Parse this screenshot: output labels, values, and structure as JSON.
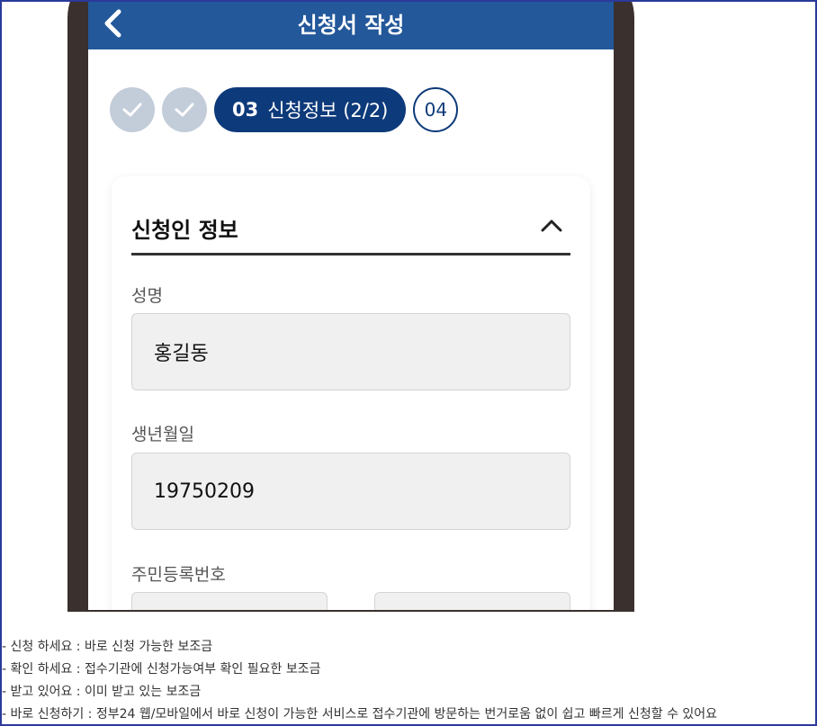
{
  "appbar": {
    "title": "신청서 작성",
    "back_icon": "chevron-left-icon"
  },
  "stepper": {
    "steps_done": 2,
    "current": {
      "number": "03",
      "label": "신청정보 (2/2)"
    },
    "next": {
      "number": "04"
    },
    "colors": {
      "done": "#c3ccd9",
      "current": "#0d3a7a"
    }
  },
  "section": {
    "title": "신청인 정보",
    "toggle_icon": "chevron-up-icon",
    "fields": {
      "name_label": "성명",
      "name_value": "홍길동",
      "birth_label": "생년월일",
      "birth_value": "19750209",
      "rrn_label": "주민등록번호"
    }
  },
  "notes": [
    "- 신청 하세요 : 바로 신청 가능한 보조금",
    "- 확인 하세요 : 접수기관에 신청가능여부 확인 필요한 보조금",
    "- 받고 있어요 : 이미 받고 있는 보조금",
    "- 바로 신청하기 : 정부24 웹/모바일에서 바로 신청이 가능한 서비스로 접수기관에 방문하는 번거로움 없이 쉽고 빠르게 신청할 수 있어요"
  ],
  "colors": {
    "appbar": "#23589a",
    "frame_border": "#2b3a9a",
    "phone_body": "#3a302d"
  }
}
